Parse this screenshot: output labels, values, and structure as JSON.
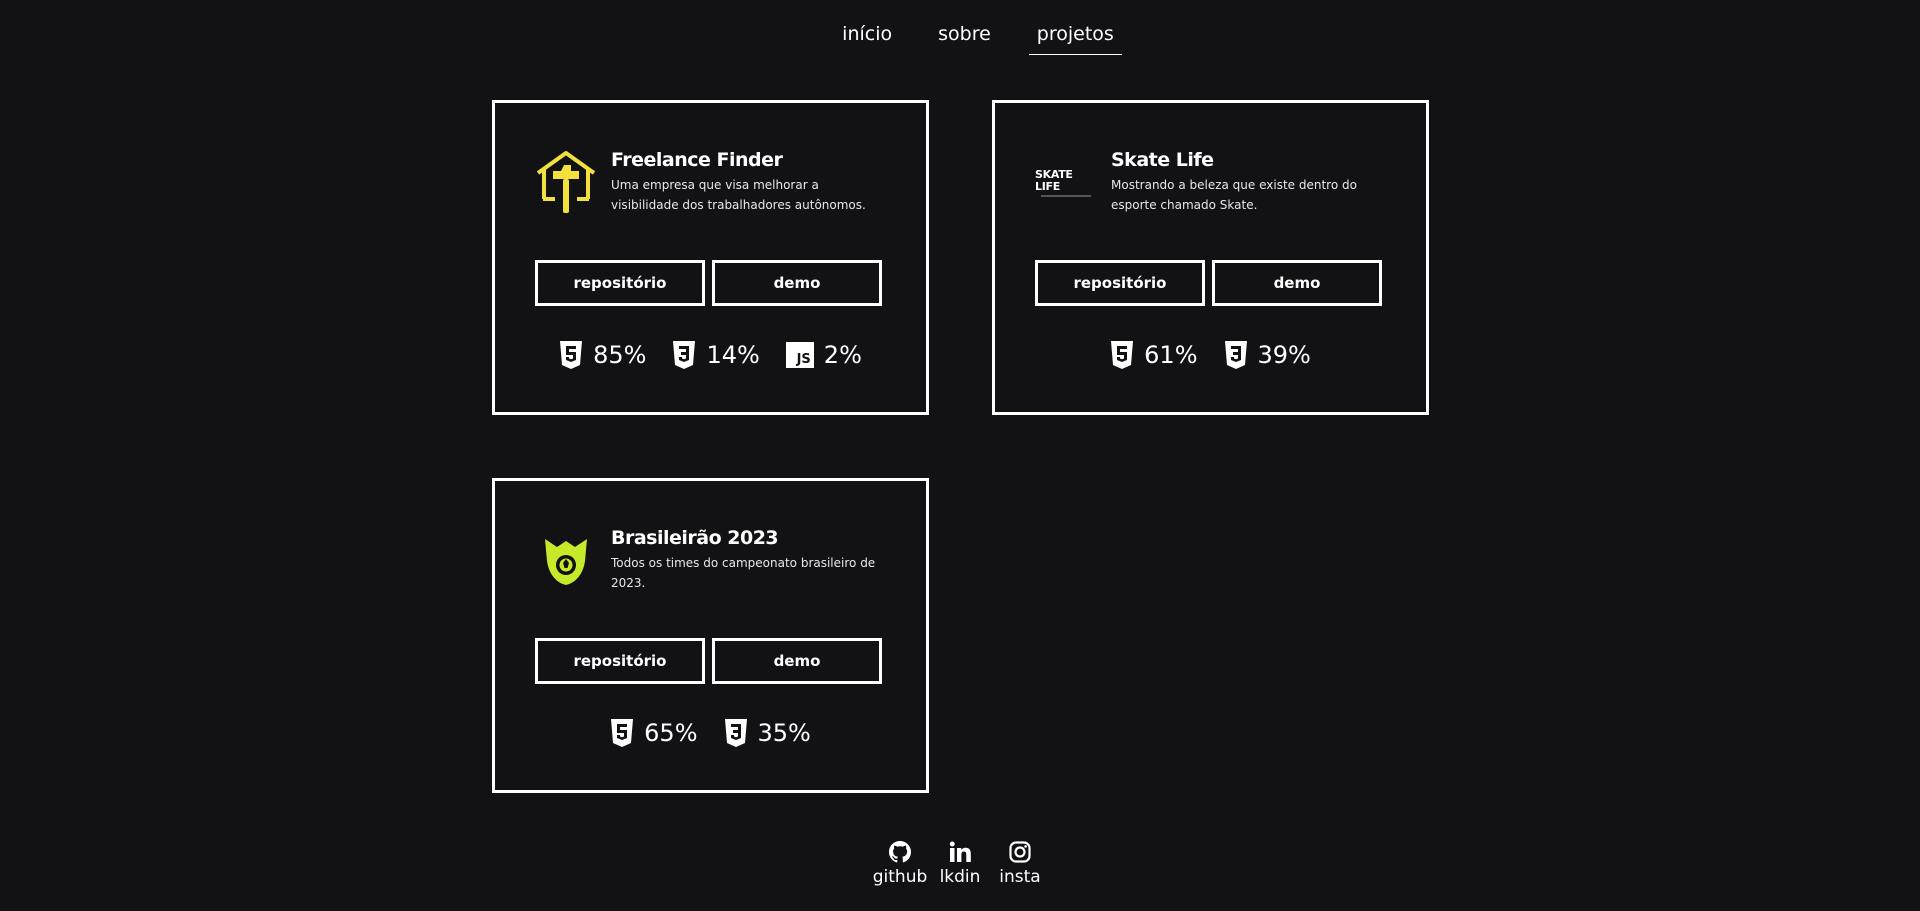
{
  "nav": {
    "items": [
      {
        "label": "início",
        "active": false
      },
      {
        "label": "sobre",
        "active": false
      },
      {
        "label": "projetos",
        "active": true
      }
    ]
  },
  "projects": [
    {
      "title": "Freelance Finder",
      "description": "Uma empresa que visa melhorar a visibilidade dos trabalhadores autônomos.",
      "logo": "house-hammer-icon",
      "repo_label": "repositório",
      "demo_label": "demo",
      "techs": [
        {
          "icon": "html5-icon",
          "percent": "85%"
        },
        {
          "icon": "css3-icon",
          "percent": "14%"
        },
        {
          "icon": "js-icon",
          "label": "JS",
          "percent": "2%"
        }
      ]
    },
    {
      "title": "Skate Life",
      "description": "Mostrando a beleza que existe dentro do esporte chamado Skate.",
      "logo": "skate-life-logo",
      "logo_text": "SKATE LIFE",
      "repo_label": "repositório",
      "demo_label": "demo",
      "techs": [
        {
          "icon": "html5-icon",
          "percent": "61%"
        },
        {
          "icon": "css3-icon",
          "percent": "39%"
        }
      ]
    },
    {
      "title": "Brasileirão 2023",
      "description": "Todos os times do campeonato brasileiro de 2023.",
      "logo": "brasileirao-shield-icon",
      "repo_label": "repositório",
      "demo_label": "demo",
      "techs": [
        {
          "icon": "html5-icon",
          "percent": "65%"
        },
        {
          "icon": "css3-icon",
          "percent": "35%"
        }
      ]
    }
  ],
  "footer": {
    "links": [
      {
        "icon": "github-icon",
        "label": "github"
      },
      {
        "icon": "linkedin-icon",
        "label": "lkdin"
      },
      {
        "icon": "instagram-icon",
        "label": "insta"
      }
    ]
  },
  "colors": {
    "background": "#121214",
    "text": "#ffffff",
    "freelance_accent": "#f2e13c",
    "brasileirao_accent": "#c6e92a"
  }
}
